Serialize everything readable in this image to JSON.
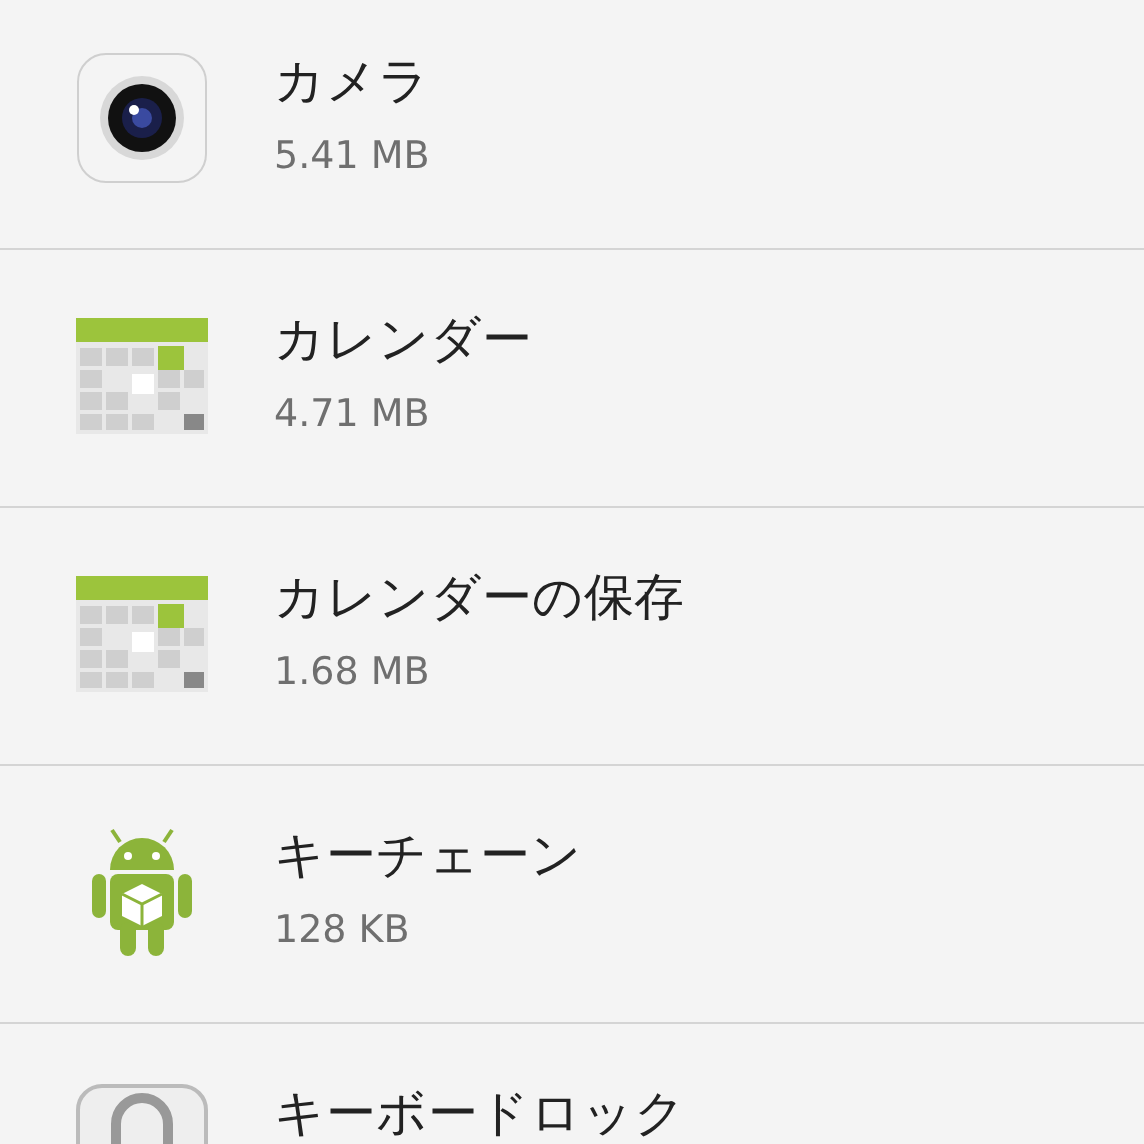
{
  "apps": [
    {
      "name": "カメラ",
      "size": "5.41 MB"
    },
    {
      "name": "カレンダー",
      "size": "4.71 MB"
    },
    {
      "name": "カレンダーの保存",
      "size": "1.68 MB"
    },
    {
      "name": "キーチェーン",
      "size": "128 KB"
    },
    {
      "name": "キーボードロック"
    }
  ]
}
